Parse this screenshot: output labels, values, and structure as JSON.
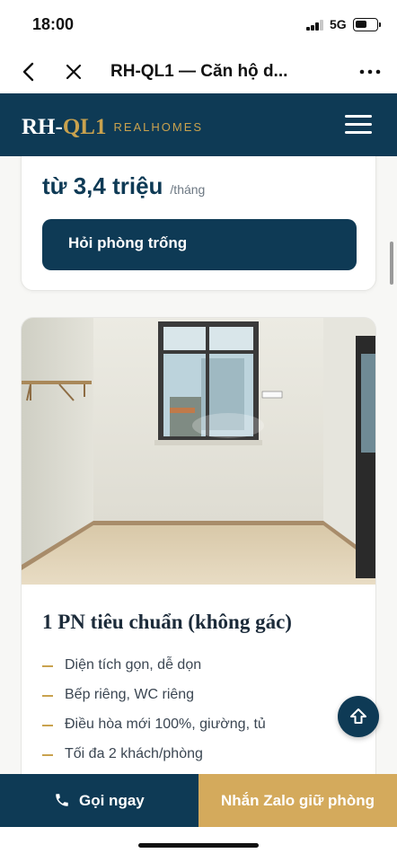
{
  "status_bar": {
    "time": "18:00",
    "network": "5G"
  },
  "browser": {
    "title": "RH-QL1 — Căn hộ d..."
  },
  "site": {
    "logo_prefix": "RH-",
    "logo_accent": "QL1",
    "logo_sub": "REALHOMES",
    "brand_color": "#0e3a55",
    "accent_color": "#c9a24e"
  },
  "price_card": {
    "price": "từ 3,4 triệu",
    "unit": "/tháng",
    "ask_button": "Hỏi phòng trống"
  },
  "room_card": {
    "title": "1 PN tiêu chuẩn (không gác)",
    "features": [
      "Diện tích gọn, dễ dọn",
      "Bếp riêng, WC riêng",
      "Điều hòa mới 100%, giường, tủ",
      "Tối đa 2 khách/phòng"
    ]
  },
  "cta": {
    "call_label": "Gọi ngay",
    "zalo_label": "Nhắn Zalo giữ phòng",
    "zalo_color": "#d4aa5c"
  }
}
